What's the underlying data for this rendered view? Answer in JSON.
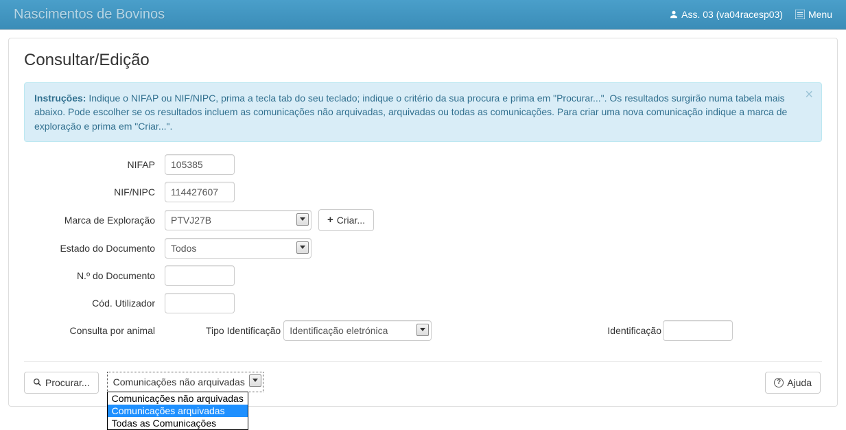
{
  "topbar": {
    "title": "Nascimentos de Bovinos",
    "user": "Ass. 03 (va04racesp03)",
    "menu": "Menu"
  },
  "page": {
    "title": "Consultar/Edição"
  },
  "alert": {
    "label": "Instruções:",
    "text": " Indique o NIFAP ou NIF/NIPC, prima a tecla tab do seu teclado; indique o critério da sua procura e prima em \"Procurar...\". Os resultados surgirão numa tabela mais abaixo. Pode escolher se os resultados incluem as comunicações não arquivadas, arquivadas ou todas as comunicações. Para criar uma nova comunicação indique a marca de exploração e prima em \"Criar...\"."
  },
  "form": {
    "nifap": {
      "label": "NIFAP",
      "value": "105385"
    },
    "nifnipc": {
      "label": "NIF/NIPC",
      "value": "114427607"
    },
    "marca": {
      "label": "Marca de Exploração",
      "value": "PTVJ27B",
      "criar": "Criar..."
    },
    "estado": {
      "label": "Estado do Documento",
      "value": "Todos"
    },
    "ndoc": {
      "label": "N.º do Documento",
      "value": ""
    },
    "codutil": {
      "label": "Cód. Utilizador",
      "value": ""
    },
    "consulta": {
      "label": "Consulta por animal",
      "tipo_label": "Tipo Identificação",
      "tipo_value": "Identificação eletrónica",
      "ident_label": "Identificação",
      "ident_value": ""
    }
  },
  "footer": {
    "procurar": "Procurar...",
    "filter_value": "Comunicações não arquivadas",
    "filter_options": [
      "Comunicações não arquivadas",
      "Comunicações arquivadas",
      "Todas as Comunicações"
    ],
    "ajuda": "Ajuda"
  }
}
